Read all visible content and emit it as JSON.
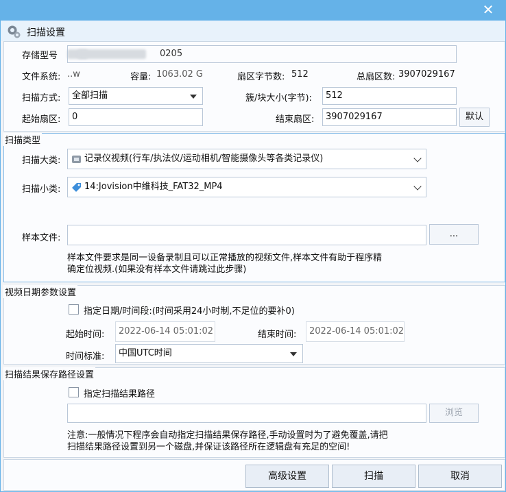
{
  "window": {
    "title": "扫描设置",
    "close_glyph": "✕"
  },
  "device": {
    "model_label": "存储型号",
    "model_value_visible": "0205",
    "fs_label": "文件系统:",
    "fs_value_visible": "..w",
    "capacity_label": "容量:",
    "capacity_value_visible": "1063.02 G",
    "sector_bytes_label": "扇区字节数:",
    "sector_bytes_value": "512",
    "total_sectors_label": "总扇区数:",
    "total_sectors_value": "3907029167",
    "scan_mode_label": "扫描方式:",
    "scan_mode_value": "全部扫描",
    "cluster_label": "簇/块大小(字节):",
    "cluster_value": "512",
    "start_sector_label": "起始扇区:",
    "start_sector_value": "0",
    "end_sector_label": "结束扇区:",
    "end_sector_value": "3907029167",
    "default_button": "默认"
  },
  "scan_type": {
    "legend": "扫描类型",
    "major_label": "扫描大类:",
    "major_value": "记录仪视频(行车/执法仪/运动相机/智能摄像头等各类记录仪)",
    "minor_label": "扫描小类:",
    "minor_value": "14:Jovision中维科技_FAT32_MP4",
    "sample_label": "样本文件:",
    "sample_value": "",
    "browse_dots": "...",
    "note_line1": "样本文件要求是同一设备录制且可以正常播放的视频文件,样本文件有助于程序精",
    "note_line2": "确定位视频.(如果没有样本文件请跳过此步骤)"
  },
  "date_params": {
    "legend": "视频日期参数设置",
    "checkbox_label": "指定日期/时间段:(时间采用24小时制,不足位的要补0)",
    "start_label": "起始时间:",
    "start_value": "2022-06-14 05:01:02",
    "end_label": "结束时间:",
    "end_value": "2022-06-14 05:01:02",
    "tz_label": "时间标准:",
    "tz_value": "中国UTC时间"
  },
  "result_path": {
    "legend": "扫描结果保存路径设置",
    "checkbox_label": "指定扫描结果路径",
    "path_value": "",
    "browse_button": "浏览",
    "note_line1": "注意:一般情况下程序会自动指定扫描结果保存路径,手动设置时为了避免覆盖,请把",
    "note_line2": "扫描结果路径设置到另一个磁盘,并保证该路径所在逻辑盘有充足的空间!"
  },
  "footer": {
    "advanced_button": "高级设置",
    "scan_button": "扫描",
    "cancel_button": "取消"
  }
}
